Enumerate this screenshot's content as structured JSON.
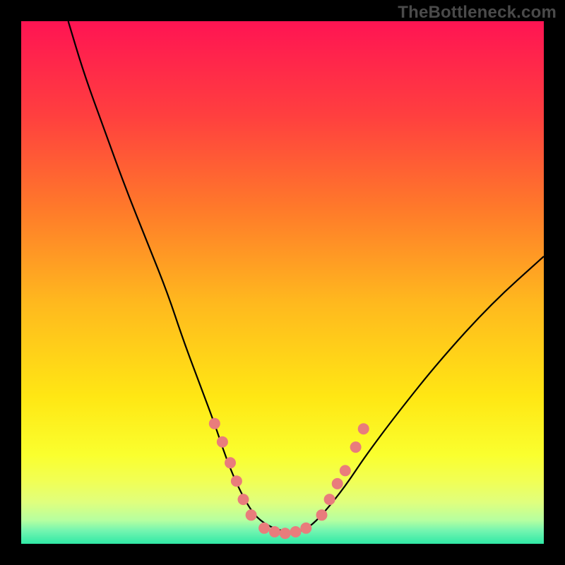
{
  "watermark": "TheBottleneck.com",
  "chart_data": {
    "type": "line",
    "title": "",
    "xlabel": "",
    "ylabel": "",
    "xlim": [
      0,
      100
    ],
    "ylim": [
      0,
      100
    ],
    "grid": false,
    "legend": false,
    "background_gradient_stops": [
      {
        "offset": 0.0,
        "color": "#ff1453"
      },
      {
        "offset": 0.18,
        "color": "#ff3f3f"
      },
      {
        "offset": 0.36,
        "color": "#ff7a2a"
      },
      {
        "offset": 0.54,
        "color": "#ffb91e"
      },
      {
        "offset": 0.72,
        "color": "#ffe714"
      },
      {
        "offset": 0.83,
        "color": "#faff2e"
      },
      {
        "offset": 0.88,
        "color": "#f1ff55"
      },
      {
        "offset": 0.92,
        "color": "#e0ff7d"
      },
      {
        "offset": 0.955,
        "color": "#b6ffa0"
      },
      {
        "offset": 0.975,
        "color": "#73f5b0"
      },
      {
        "offset": 1.0,
        "color": "#30e9a6"
      }
    ],
    "series": [
      {
        "name": "bottleneck-curve",
        "color": "#000000",
        "x": [
          9,
          12,
          16,
          20,
          24,
          28,
          31,
          34,
          37,
          39,
          41,
          43,
          45,
          48,
          52,
          55,
          58,
          62,
          66,
          72,
          80,
          90,
          100
        ],
        "y": [
          100,
          90,
          79,
          68,
          58,
          48,
          39,
          31,
          23,
          17,
          12,
          8,
          5,
          3,
          2,
          3,
          6,
          11,
          17,
          25,
          35,
          46,
          55
        ]
      }
    ],
    "markers": {
      "name": "highlight-dots",
      "color": "#e97c7c",
      "radius_px": 8,
      "points": [
        {
          "x": 37.0,
          "y": 23.0
        },
        {
          "x": 38.5,
          "y": 19.5
        },
        {
          "x": 40.0,
          "y": 15.5
        },
        {
          "x": 41.2,
          "y": 12.0
        },
        {
          "x": 42.5,
          "y": 8.5
        },
        {
          "x": 44.0,
          "y": 5.5
        },
        {
          "x": 46.5,
          "y": 3.0
        },
        {
          "x": 48.5,
          "y": 2.3
        },
        {
          "x": 50.5,
          "y": 2.0
        },
        {
          "x": 52.5,
          "y": 2.3
        },
        {
          "x": 54.5,
          "y": 3.0
        },
        {
          "x": 57.5,
          "y": 5.5
        },
        {
          "x": 59.0,
          "y": 8.5
        },
        {
          "x": 60.5,
          "y": 11.5
        },
        {
          "x": 62.0,
          "y": 14.0
        },
        {
          "x": 64.0,
          "y": 18.5
        },
        {
          "x": 65.5,
          "y": 22.0
        }
      ]
    }
  }
}
